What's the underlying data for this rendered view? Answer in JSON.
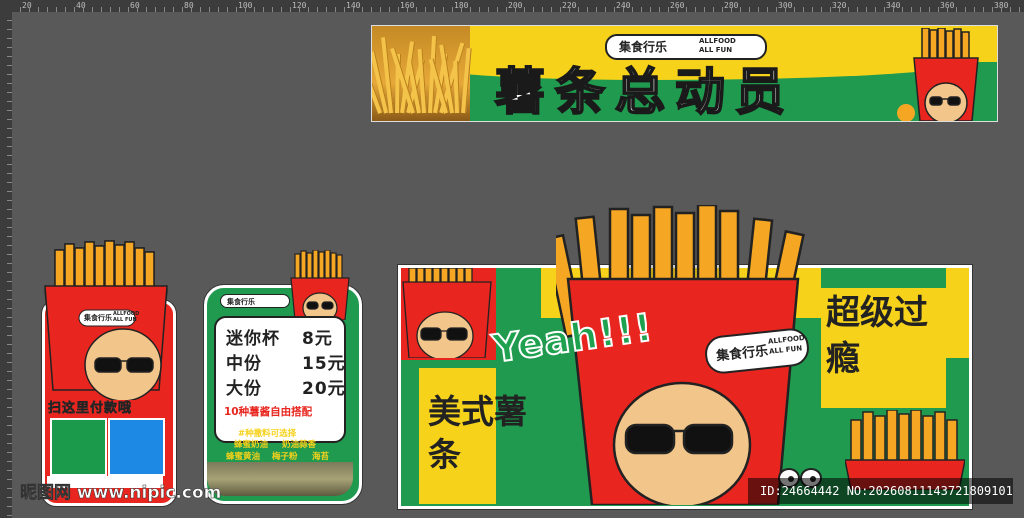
{
  "ruler": {
    "top_labels": [
      "20",
      "40",
      "60",
      "80",
      "100",
      "120",
      "140",
      "160",
      "180",
      "200",
      "220",
      "240",
      "260",
      "280",
      "300",
      "320",
      "340",
      "360",
      "380"
    ]
  },
  "banner": {
    "brand_cn": "集食行乐",
    "brand_en_1": "ALLFOOD",
    "brand_en_2": "ALL FUN",
    "title": "薯条总动员"
  },
  "card1": {
    "brand_cn": "集食行乐",
    "brand_en_1": "ALLFOOD",
    "brand_en_2": "ALL FUN",
    "scan_text": "扫这里付款哦"
  },
  "card2": {
    "brand_cn": "集食行乐",
    "brand_en_1": "ALLFOOD",
    "brand_en_2": "ALL FUN",
    "menu": [
      {
        "name": "迷你杯",
        "price": "8元"
      },
      {
        "name": "中份",
        "price": "15元"
      },
      {
        "name": "大份",
        "price": "20元"
      }
    ],
    "sauce_line": "10种薯酱自由搭配",
    "options_title": "#种撒料可选择",
    "options": [
      "蜂蜜奶油",
      "奶油蒜香",
      "蜂蜜黄油",
      "梅子粉",
      "海苔"
    ]
  },
  "sign": {
    "yeah": "Yeah!!!",
    "left_text": "美式薯条",
    "right_text": "超级过瘾",
    "brand_cn": "集食行乐",
    "brand_en_1": "ALLFOOD",
    "brand_en_2": "ALL FUN"
  },
  "watermark": {
    "site": "昵图网 www.nipic.com",
    "id_text": "ID:24664442 NO:20260811143721809101"
  },
  "colors": {
    "red": "#e8261f",
    "green": "#1f9a4f",
    "yellow": "#f6d21b",
    "fries": "#f5a623"
  }
}
